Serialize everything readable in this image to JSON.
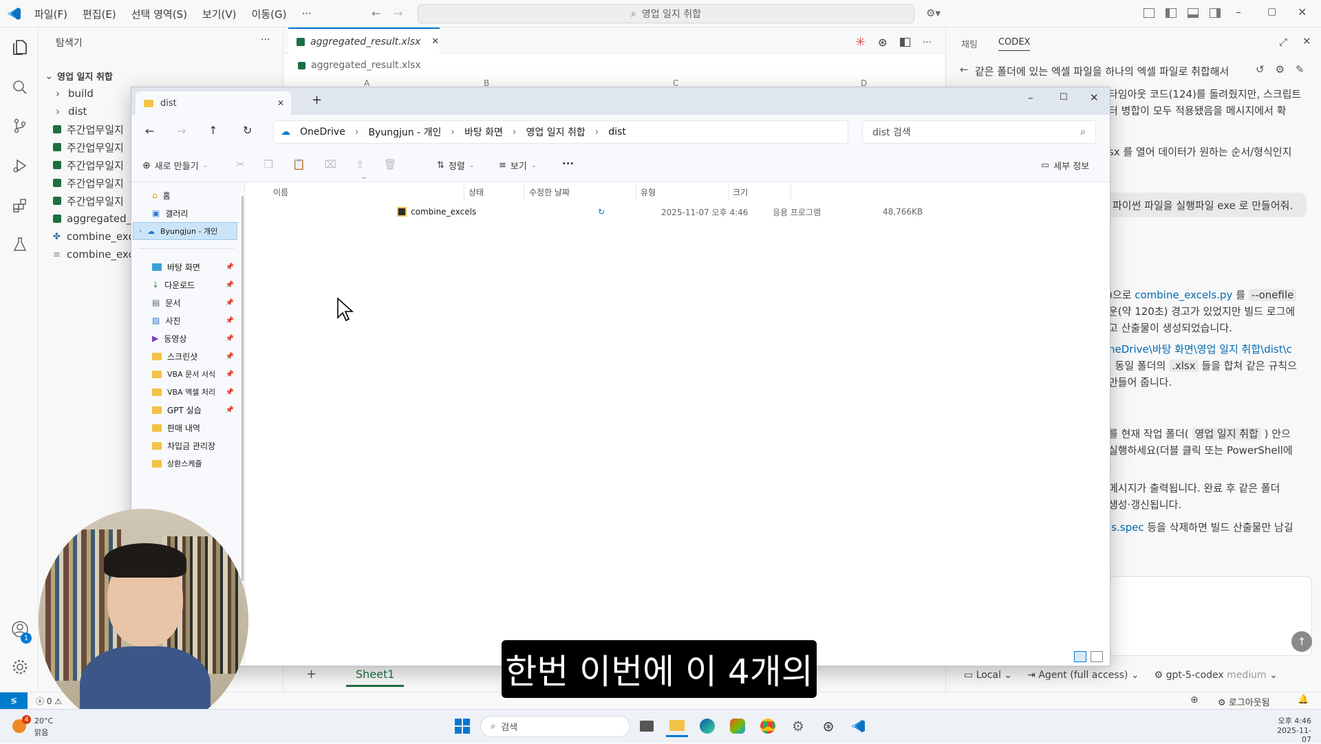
{
  "titlebar": {
    "menus": [
      "파일(F)",
      "편집(E)",
      "선택 영역(S)",
      "보기(V)",
      "이동(G)",
      "···"
    ],
    "search": "영업 일지 취합"
  },
  "explorer": {
    "title": "탐색기",
    "more": "···",
    "root": "영업 일지 취합",
    "items": [
      {
        "label": "build",
        "kind": "folder"
      },
      {
        "label": "dist",
        "kind": "folder"
      },
      {
        "label": "주간업무일지",
        "kind": "xlsx"
      },
      {
        "label": "주간업무일지",
        "kind": "xlsx"
      },
      {
        "label": "주간업무일지",
        "kind": "xlsx"
      },
      {
        "label": "주간업무일지",
        "kind": "xlsx"
      },
      {
        "label": "주간업무일지",
        "kind": "xlsx"
      },
      {
        "label": "aggregated_r",
        "kind": "xlsx"
      },
      {
        "label": "combine_exce",
        "kind": "py"
      },
      {
        "label": "combine_exce",
        "kind": "txt"
      }
    ]
  },
  "editor": {
    "tab_label": "aggregated_result.xlsx",
    "breadcrumb": "aggregated_result.xlsx",
    "col_headers": [
      "A",
      "B",
      "C",
      "D"
    ],
    "sheet_add": "+",
    "sheet_tab": "Sheet1"
  },
  "chat": {
    "tabs": [
      "채팅",
      "CODEX"
    ],
    "thread_title": "같은 폴더에 있는 엑셀 파일을 하나의 엑셀 파일로 취합해서",
    "lines": [
      "타임아웃 코드(124)를 돌려줬지만, 스크립트",
      "터 병합이 모두 적용됐음을 메시지에서 확",
      "sx 를 열어 데이터가 원하는 순서/형식인지"
    ],
    "user_message": "파이썬 파일을 실행파일 exe 로 만들어줘.",
    "reply1_prefix": ")으로",
    "reply1_link": "combine_excels.py",
    "reply1_mid": "를",
    "reply1_chip": "--onefile",
    "reply2": "운(약 120초) 경고가 있었지만 빌드 로그에",
    "reply3": "고 산출물이 생성되었습니다.",
    "reply4_link": "neDrive\\바탕 화면\\영업 일지 취합\\dist\\c",
    "reply5_pre": ". 동일 폴더의",
    "reply5_chip": ".xlsx",
    "reply5_post": "들을 합쳐 같은 규칙으",
    "reply6": "만들어 줍니다.",
    "reply7_pre": "를 현재 작업 폴더(",
    "reply7_chip": "영업 일지 취합",
    "reply7_post": ") 안으",
    "reply8": "실행하세요(더블 클릭 또는 PowerShell에",
    "reply9": ".",
    "reply10": "메시지가 출력됩니다. 완료 후 같은 폴더",
    "reply11": "생성·갱신됩니다.",
    "reply12_link": "ls.spec",
    "reply12_post": "등을 삭제하면 빌드 산출물만 남길",
    "footer": {
      "local": "Local",
      "agent": "Agent (full access)",
      "model": "gpt-5-codex",
      "effort": "medium"
    }
  },
  "file_explorer": {
    "tab_title": "dist",
    "new_tab": "+",
    "breadcrumb": [
      "OneDrive",
      "Byungjun - 개인",
      "바탕 화면",
      "영업 일지 취합",
      "dist"
    ],
    "search_placeholder": "dist 검색",
    "toolbar": {
      "new": "새로 만들기",
      "sort": "정렬",
      "view": "보기",
      "more": "···",
      "details": "세부 정보"
    },
    "columns": [
      "이름",
      "상태",
      "수정한 날짜",
      "유형",
      "크기"
    ],
    "files": [
      {
        "name": "combine_excels",
        "status": "sync",
        "modified": "2025-11-07 오후 4:46",
        "type": "응용 프로그램",
        "size": "48,766KB"
      }
    ],
    "nav": {
      "home": "홈",
      "gallery": "갤러리",
      "onedrive": "Byungjun - 개인",
      "quick": [
        {
          "label": "바탕 화면",
          "icon": "desktop-icon"
        },
        {
          "label": "다운로드",
          "icon": "download-icon"
        },
        {
          "label": "문서",
          "icon": "document-icon"
        },
        {
          "label": "사진",
          "icon": "picture-icon"
        },
        {
          "label": "동영상",
          "icon": "video-icon"
        },
        {
          "label": "스크린샷",
          "icon": "folder-icon"
        },
        {
          "label": "VBA 문서 서식",
          "icon": "folder-icon"
        },
        {
          "label": "VBA 엑셀 처리",
          "icon": "folder-icon"
        },
        {
          "label": "GPT 실습",
          "icon": "folder-icon"
        },
        {
          "label": "판매 내역",
          "icon": "folder-icon"
        },
        {
          "label": "차입금 관리장",
          "icon": "folder-icon"
        },
        {
          "label": "상환스케쥴",
          "icon": "folder-icon"
        }
      ]
    }
  },
  "statusbar": {
    "errors": "0"
  },
  "taskbar": {
    "weather_temp": "20°C",
    "weather_desc": "맑음",
    "weather_badge": "4",
    "search": "검색",
    "time": "오후 4:46",
    "date": "2025-11-07"
  },
  "status_right": {
    "account": "로그아웃됨"
  },
  "accounts_badge": "1",
  "caption": "한번 이번에 이 4개의",
  "colors": {
    "accent": "#0078d4",
    "vscode_blue": "#007acc",
    "excel_green": "#1d6f42"
  }
}
